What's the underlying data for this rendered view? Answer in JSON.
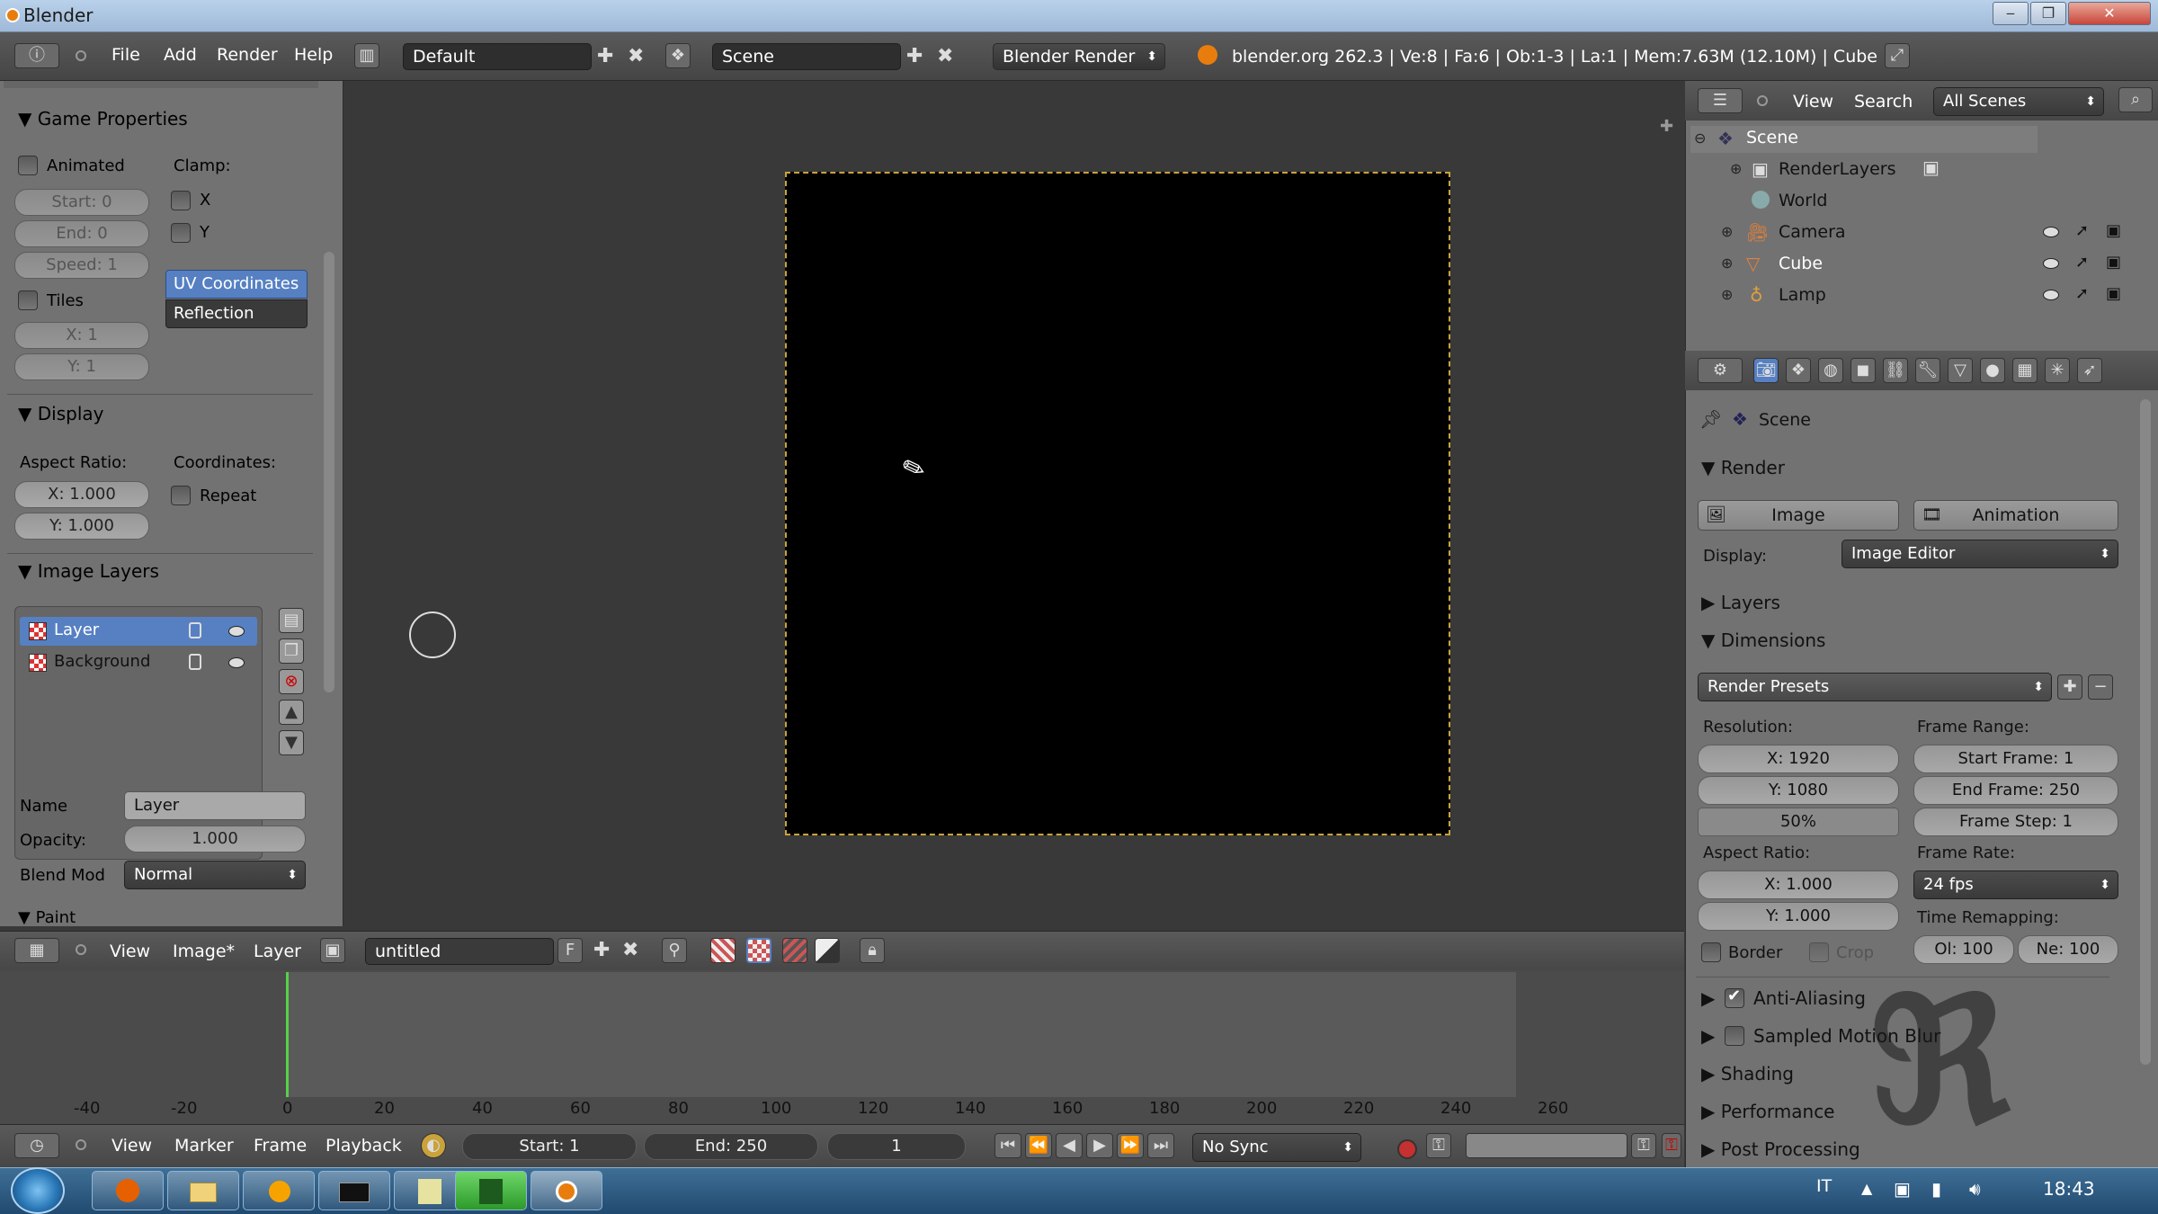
{
  "window": {
    "title": "Blender",
    "min": "‒",
    "max": "❐",
    "close": "✕"
  },
  "topbar": {
    "menus": [
      "File",
      "Add",
      "Render",
      "Help"
    ],
    "screen_layout": "Default",
    "scene": "Scene",
    "engine": "Blender Render",
    "info": "blender.org 262.3 | Ve:8 | Fa:6 | Ob:1-3 | La:1 | Mem:7.63M (12.10M) | Cube"
  },
  "leftpanel": {
    "game_properties": {
      "title": "Game Properties",
      "animated": "Animated",
      "clamp": "Clamp:",
      "start": "Start: 0",
      "end": "End: 0",
      "speed": "Speed: 1",
      "x": "X",
      "y": "Y",
      "tiles": "Tiles",
      "tx": "X: 1",
      "ty": "Y: 1",
      "uv_coords": "UV Coordinates",
      "reflection": "Reflection"
    },
    "display": {
      "title": "Display",
      "aspect_ratio": "Aspect Ratio:",
      "coordinates": "Coordinates:",
      "x": "X: 1.000",
      "y": "Y: 1.000",
      "repeat": "Repeat"
    },
    "image_layers": {
      "title": "Image Layers",
      "layers": [
        "Layer",
        "Background"
      ]
    },
    "name_label": "Name",
    "name_value": "Layer",
    "opacity_label": "Opacity:",
    "opacity_value": "1.000",
    "blend_label": "Blend Mod",
    "blend_value": "Normal",
    "paint": "Paint"
  },
  "image_editor": {
    "menus": [
      "View",
      "Image*",
      "Layer"
    ],
    "image_name": "untitled",
    "f_label": "F"
  },
  "timeline": {
    "ticks": [
      "-40",
      "-20",
      "0",
      "20",
      "40",
      "60",
      "80",
      "100",
      "120",
      "140",
      "160",
      "180",
      "200",
      "220",
      "240",
      "260"
    ],
    "menus": [
      "View",
      "Marker",
      "Frame",
      "Playback"
    ],
    "start": "Start: 1",
    "end": "End: 250",
    "current": "1",
    "sync": "No Sync"
  },
  "outliner": {
    "menus": [
      "View",
      "Search"
    ],
    "filter": "All Scenes",
    "items": [
      "Scene",
      "RenderLayers",
      "World",
      "Camera",
      "Cube",
      "Lamp"
    ]
  },
  "properties": {
    "context": "Scene",
    "render": {
      "title": "Render",
      "image": "Image",
      "animation": "Animation",
      "display_label": "Display:",
      "display_value": "Image Editor"
    },
    "layers": "Layers",
    "dimensions": {
      "title": "Dimensions",
      "presets": "Render Presets",
      "resolution": "Resolution:",
      "res_x": "X: 1920",
      "res_y": "Y: 1080",
      "percent": "50%",
      "frame_range": "Frame Range:",
      "start_frame": "Start Frame: 1",
      "end_frame": "End Frame: 250",
      "frame_step": "Frame Step: 1",
      "aspect_ratio": "Aspect Ratio:",
      "asp_x": "X: 1.000",
      "asp_y": "Y: 1.000",
      "frame_rate": "Frame Rate:",
      "fps": "24 fps",
      "time_remap": "Time Remapping:",
      "old": "Ol: 100",
      "new": "Ne: 100",
      "border": "Border",
      "crop": "Crop"
    },
    "anti_aliasing": "Anti-Aliasing",
    "motion_blur": "Sampled Motion Blur",
    "shading": "Shading",
    "performance": "Performance",
    "post_processing": "Post Processing"
  },
  "taskbar": {
    "lang": "IT",
    "clock": "18:43"
  }
}
